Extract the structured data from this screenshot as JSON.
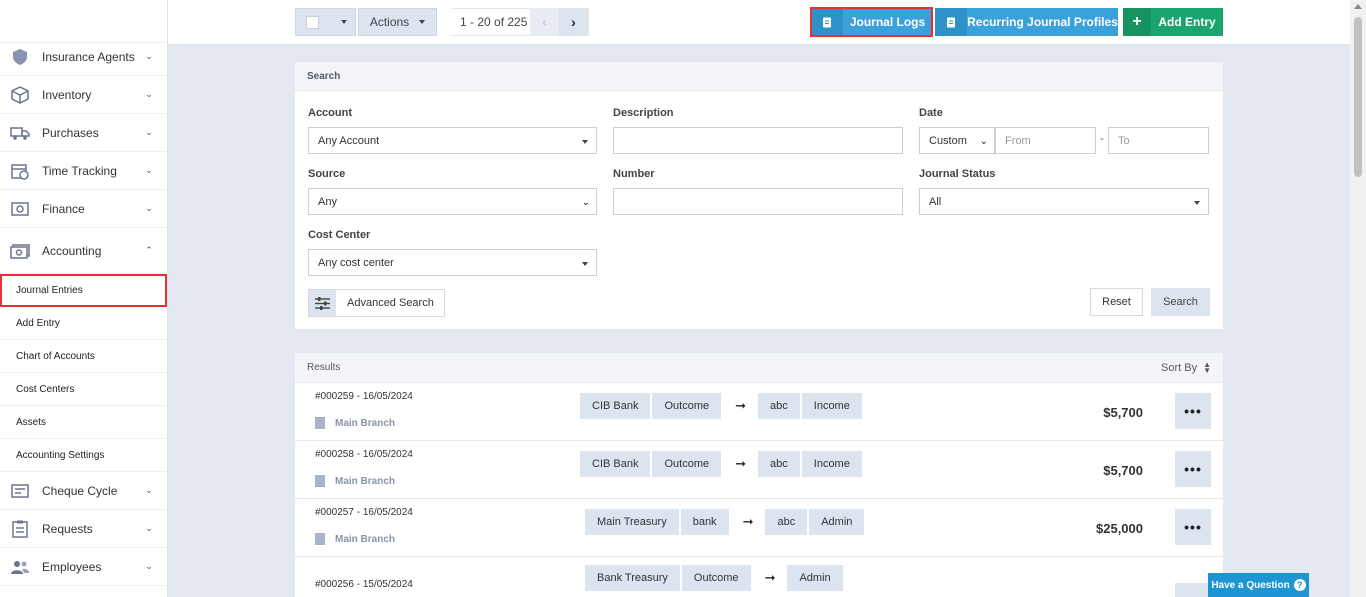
{
  "sidebar": {
    "items": [
      {
        "label": "Insurance Agents",
        "icon": "shield-icon"
      },
      {
        "label": "Inventory",
        "icon": "box-icon"
      },
      {
        "label": "Purchases",
        "icon": "truck-icon"
      },
      {
        "label": "Time Tracking",
        "icon": "calendar-clock-icon"
      },
      {
        "label": "Finance",
        "icon": "money-icon"
      },
      {
        "label": "Accounting",
        "icon": "cash-icon"
      }
    ],
    "accounting_sub": [
      {
        "label": "Journal Entries"
      },
      {
        "label": "Add Entry"
      },
      {
        "label": "Chart of Accounts"
      },
      {
        "label": "Cost Centers"
      },
      {
        "label": "Assets"
      },
      {
        "label": "Accounting Settings"
      }
    ],
    "items_after": [
      {
        "label": "Cheque Cycle",
        "icon": "cheque-icon"
      },
      {
        "label": "Requests",
        "icon": "clipboard-icon"
      },
      {
        "label": "Employees",
        "icon": "users-icon"
      }
    ]
  },
  "toolbar": {
    "actions_label": "Actions",
    "pagination": "1 - 20 of 225",
    "journal_logs": "Journal Logs",
    "recurring": "Recurring Journal Profiles",
    "add_entry": "Add Entry"
  },
  "search": {
    "title": "Search",
    "account_label": "Account",
    "account_value": "Any Account",
    "description_label": "Description",
    "date_label": "Date",
    "date_mode": "Custom",
    "date_from_placeholder": "From",
    "date_sep": "-",
    "date_to_placeholder": "To",
    "source_label": "Source",
    "source_value": "Any",
    "number_label": "Number",
    "status_label": "Journal Status",
    "status_value": "All",
    "cost_center_label": "Cost Center",
    "cost_center_value": "Any cost center",
    "advanced": "Advanced Search",
    "reset": "Reset",
    "search": "Search"
  },
  "results": {
    "title": "Results",
    "sort_by": "Sort By",
    "rows": [
      {
        "num": "#000259 - 16/05/2024",
        "branch": "Main Branch",
        "from": [
          "CIB Bank",
          "Outcome"
        ],
        "to": [
          "abc",
          "Income"
        ],
        "amount": "$5,700"
      },
      {
        "num": "#000258 - 16/05/2024",
        "branch": "Main Branch",
        "from": [
          "CIB Bank",
          "Outcome"
        ],
        "to": [
          "abc",
          "Income"
        ],
        "amount": "$5,700"
      },
      {
        "num": "#000257 - 16/05/2024",
        "branch": "Main Branch",
        "from": [
          "Main Treasury",
          "bank"
        ],
        "to": [
          "abc",
          "Admin"
        ],
        "amount": "$25,000"
      },
      {
        "num": "#000256 - 15/05/2024",
        "branch": "",
        "from": [
          "Bank Treasury",
          "Outcome"
        ],
        "to": [
          "Admin"
        ],
        "amount": ""
      }
    ]
  },
  "help": {
    "label": "Have a Question",
    "q": "?"
  },
  "colors": {
    "accent_blue": "#3aa2db",
    "accent_green": "#1aa56d",
    "highlight_red": "#e53238"
  }
}
